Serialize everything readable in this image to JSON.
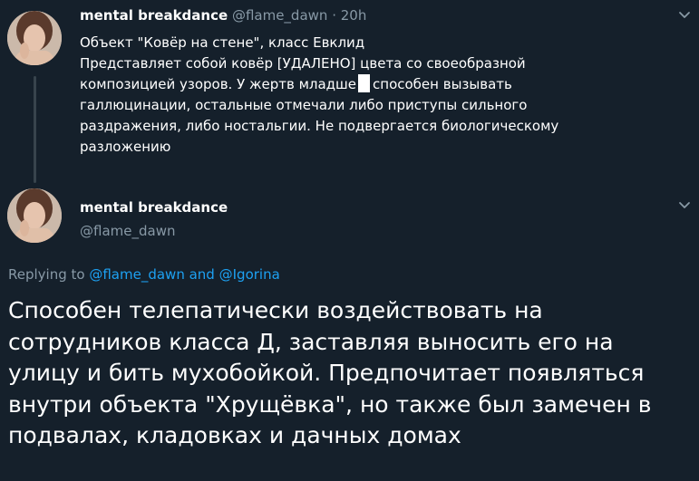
{
  "parent_tweet": {
    "author_name": "mental breakdance",
    "handle": "@flame_dawn",
    "separator": "·",
    "time": "20h",
    "line1": "Объект \"Ковёр на стене\", класс Евклид",
    "line2": "Представляет собой ковёр [УДАЛЕНО] цвета со своеобразной",
    "line3_before": "композицией узоров. У жертв младше",
    "line3_after": "способен вызывать",
    "line4": "галлюцинации, остальные отмечали либо приступы сильного",
    "line5": "раздражения, либо ностальгии. Не подвергается биологическому",
    "line6": "разложению"
  },
  "main_tweet": {
    "author_name": "mental breakdance",
    "handle": "@flame_dawn",
    "replying_prefix": "Replying to",
    "reply_user1": "@flame_dawn",
    "reply_and": "and",
    "reply_user2": "@Igorina",
    "line1": "Способен телепатически воздействовать на",
    "line2": "сотрудников класса Д, заставляя выносить его на",
    "line3": "улицу и бить мухобойкой. Предпочитает появляться",
    "line4": "внутри объекта \"Хрущёвка\", но также был замечен в",
    "line5": "подвалах, кладовках и дачных домах"
  },
  "icons": {
    "menu_chevron": "chevron-down-icon",
    "avatar": "profile-photo"
  },
  "colors": {
    "background": "#15202b",
    "text": "#ffffff",
    "secondary": "#8899a6",
    "link": "#1da1f2",
    "thread_line": "#38444d"
  }
}
